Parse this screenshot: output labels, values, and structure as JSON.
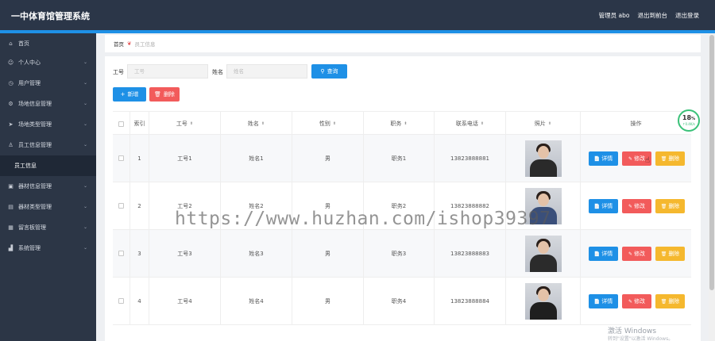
{
  "header": {
    "title": "一中体育馆管理系统",
    "admin": "管理员 abo",
    "back": "退出到前台",
    "logout": "退出登录"
  },
  "sidebar": {
    "items": [
      {
        "label": "首页",
        "icon": "home-icon",
        "glyph": "⌂",
        "chevron": false
      },
      {
        "label": "个人中心",
        "icon": "user-icon",
        "glyph": "☺",
        "chevron": true
      },
      {
        "label": "用户管理",
        "icon": "clock-icon",
        "glyph": "◷",
        "chevron": true
      },
      {
        "label": "场地信息管理",
        "icon": "gear-icon",
        "glyph": "⚙",
        "chevron": true
      },
      {
        "label": "场地类型管理",
        "icon": "send-icon",
        "glyph": "➤",
        "chevron": true
      },
      {
        "label": "员工信息管理",
        "icon": "person-icon",
        "glyph": "♙",
        "chevron": true
      },
      {
        "label": "器材信息管理",
        "icon": "box-icon",
        "glyph": "▣",
        "chevron": true
      },
      {
        "label": "器材类型管理",
        "icon": "card-icon",
        "glyph": "▤",
        "chevron": true
      },
      {
        "label": "留言板管理",
        "icon": "grid-icon",
        "glyph": "▦",
        "chevron": true
      },
      {
        "label": "系统管理",
        "icon": "chart-icon",
        "glyph": "▟",
        "chevron": true
      }
    ],
    "sub_active": "员工信息"
  },
  "breadcrumb": {
    "home": "首页",
    "current": "员工信息"
  },
  "filters": {
    "id_label": "工号",
    "id_placeholder": "工号",
    "name_label": "姓名",
    "name_placeholder": "姓名",
    "query": "查询"
  },
  "actions": {
    "add": "新增",
    "delete": "删除"
  },
  "table": {
    "headers": {
      "index": "索引",
      "id": "工号",
      "name": "姓名",
      "gender": "性别",
      "position": "职务",
      "phone": "联系电话",
      "photo": "照片",
      "ops": "操作"
    },
    "row_buttons": {
      "detail": "详情",
      "edit": "修改",
      "delete": "删除"
    },
    "rows": [
      {
        "index": "1",
        "id": "工号1",
        "name": "姓名1",
        "gender": "男",
        "position": "职务1",
        "phone": "13823888881"
      },
      {
        "index": "2",
        "id": "工号2",
        "name": "姓名2",
        "gender": "男",
        "position": "职务2",
        "phone": "13823888882"
      },
      {
        "index": "3",
        "id": "工号3",
        "name": "姓名3",
        "gender": "男",
        "position": "职务3",
        "phone": "13823888883"
      },
      {
        "index": "4",
        "id": "工号4",
        "name": "姓名4",
        "gender": "男",
        "position": "职务4",
        "phone": "13823888884"
      }
    ]
  },
  "overlay": {
    "watermark": "https://www.huzhan.com/ishop39397",
    "activate": "激活 Windows",
    "activate_sub": "转到\"设置\"以激活 Windows。",
    "progress": "18",
    "progress_unit": "%",
    "progress_speed": "↑0.4K/s"
  },
  "colors": {
    "primary": "#1e90e6",
    "danger": "#f25b5b",
    "warning": "#f5b82e",
    "sidebar": "#2c3646",
    "header": "#2b3648"
  }
}
